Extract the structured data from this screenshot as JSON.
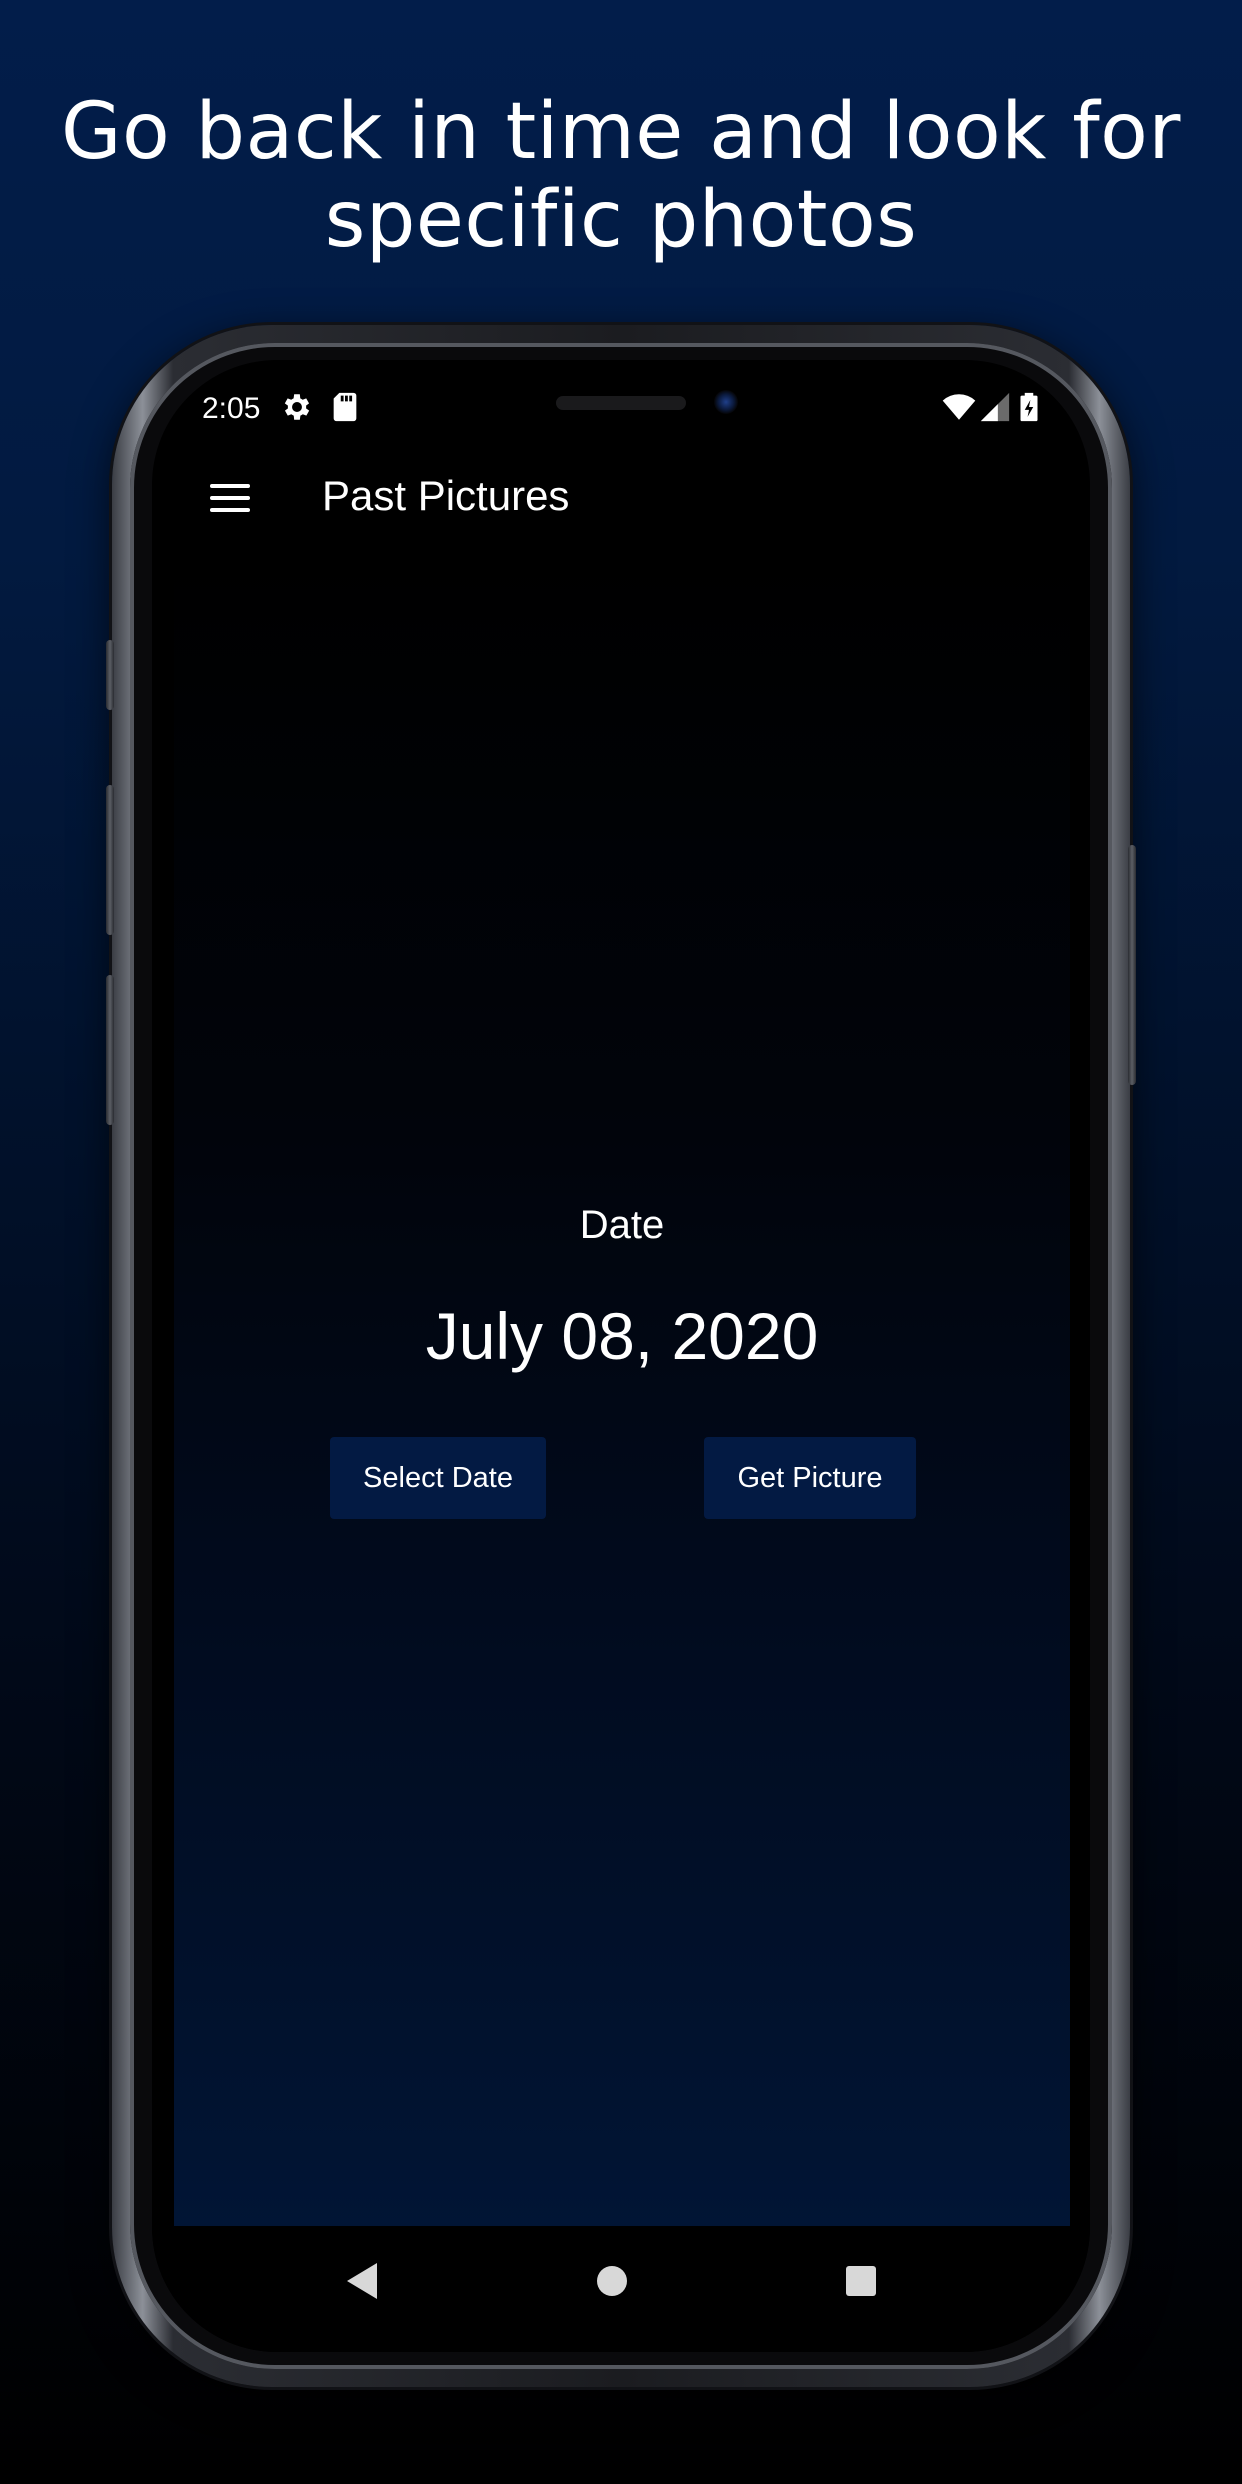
{
  "headline": {
    "line1": "Go back in time and look for",
    "line2": "specific photos"
  },
  "status_bar": {
    "time": "2:05",
    "icons": [
      "settings-icon",
      "sd-card-icon",
      "wifi-icon",
      "signal-icon",
      "battery-charging-icon"
    ]
  },
  "app_bar": {
    "menu_icon": "hamburger-menu-icon",
    "title": "Past Pictures"
  },
  "main": {
    "date_label": "Date",
    "date_value": "July 08, 2020",
    "select_date_label": "Select Date",
    "get_picture_label": "Get Picture"
  },
  "nav_bar": {
    "icons": [
      "back-icon",
      "home-icon",
      "recents-icon"
    ]
  },
  "colors": {
    "background_top": "#021d4a",
    "background_bottom": "#000000",
    "button_background": "#031a43",
    "text": "#ffffff"
  }
}
